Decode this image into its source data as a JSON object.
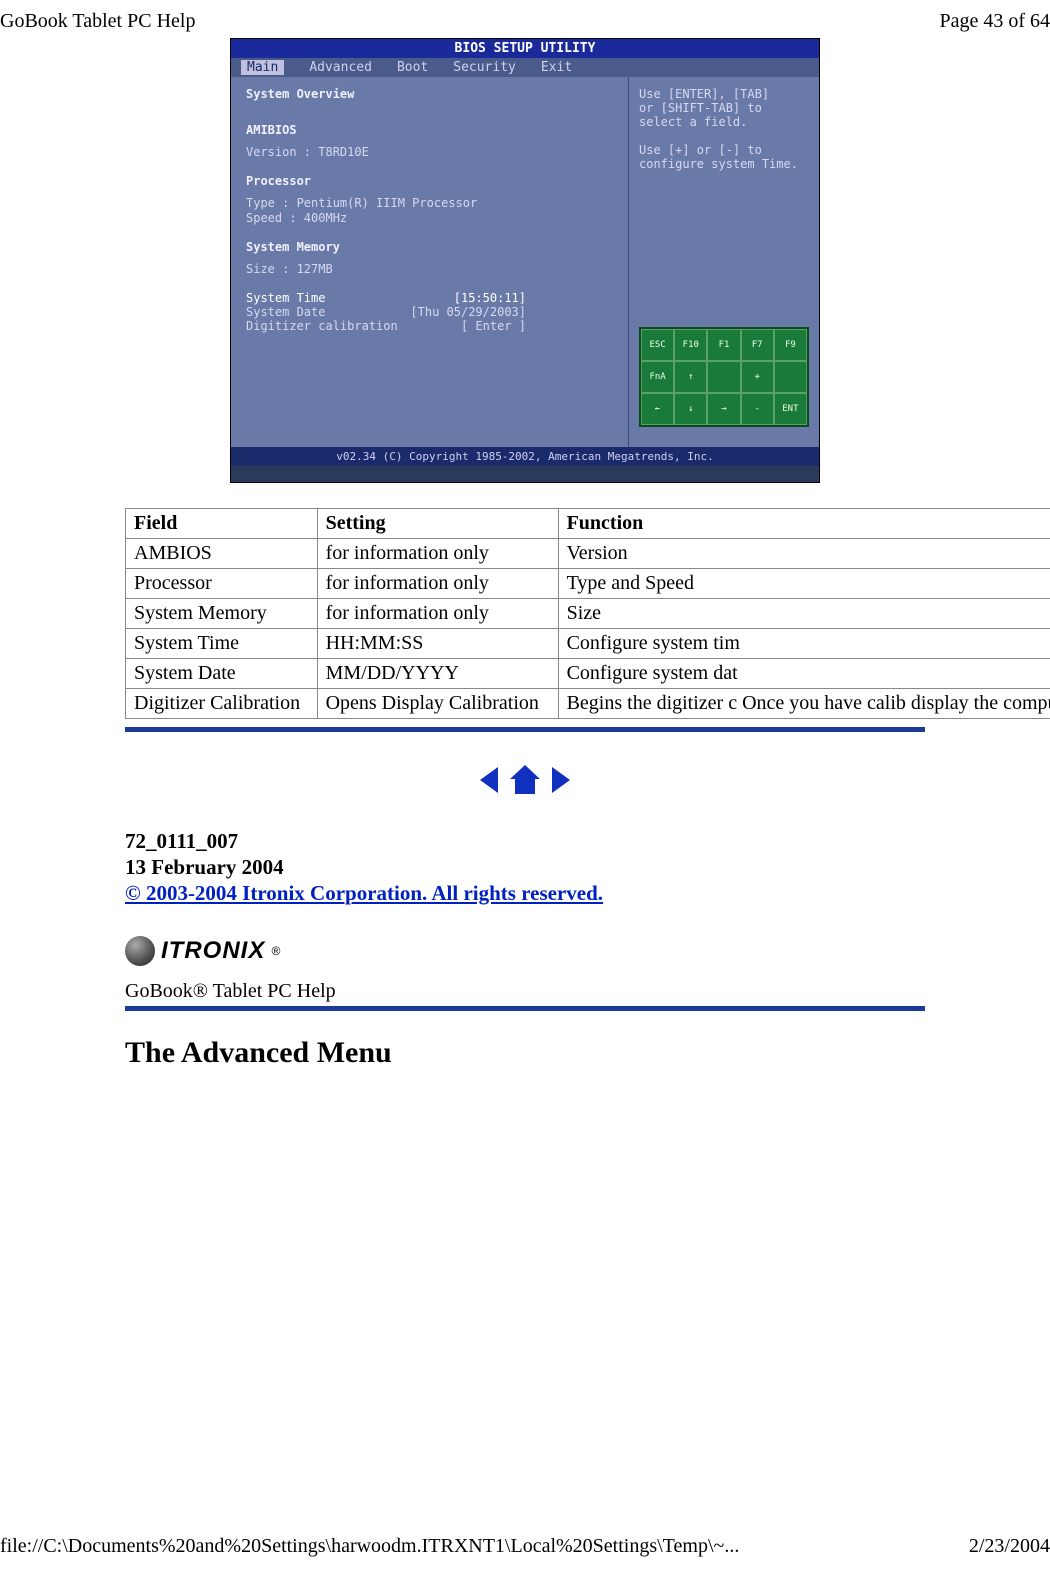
{
  "header": {
    "left": "GoBook Tablet PC Help",
    "right": "Page 43 of 64"
  },
  "bios": {
    "title": "BIOS SETUP UTILITY",
    "menu": [
      "Main",
      "Advanced",
      "Boot",
      "Security",
      "Exit"
    ],
    "left": {
      "overview": "System Overview",
      "amibios": "AMIBIOS",
      "version": "Version   : T8RD10E",
      "processor": "Processor",
      "ptype": "Type     : Pentium(R) IIIM Processor",
      "pspeed": "Speed    : 400MHz",
      "sysmem": "System Memory",
      "size": "Size     : 127MB",
      "systime": "System Time",
      "systime_val": "[15:50:11]",
      "sysdate": "System Date",
      "sysdate_val": "[Thu 05/29/2003]",
      "digi": "Digitizer calibration",
      "digi_val": "[ Enter ]"
    },
    "right": {
      "help1": "Use [ENTER], [TAB]",
      "help2": "or [SHIFT-TAB] to",
      "help3": "select a field.",
      "help4": "Use [+] or [-] to",
      "help5": "configure system Time."
    },
    "keys": [
      "ESC",
      "F10",
      "F1",
      "F7",
      "F9",
      "FnA",
      "↑",
      "",
      "+",
      "",
      "←",
      "↓",
      "→",
      "-",
      "ENT"
    ],
    "footer": "v02.34 (C) Copyright 1985-2002, American Megatrends, Inc."
  },
  "table": {
    "headers": [
      "Field",
      "Setting",
      "Function"
    ],
    "rows": [
      [
        "AMBIOS",
        "for information only",
        "Version"
      ],
      [
        "Processor",
        "for information only",
        "Type and Speed"
      ],
      [
        "System Memory",
        "for information only",
        "Size"
      ],
      [
        "System Time",
        "HH:MM:SS",
        "Configure system tim"
      ],
      [
        "System Date",
        "MM/DD/YYYY",
        "Configure system dat"
      ],
      [
        "Digitizer Calibration",
        "Opens Display Calibration",
        "Begins the digitizer c  Once you have calib display the computer restart."
      ]
    ]
  },
  "docinfo": {
    "id": "72_0111_007",
    "date": "13 February 2004",
    "copyright": "© 2003-2004 Itronix Corporation.  All rights reserved."
  },
  "logo_text": "ITRONIX",
  "subtitle": "GoBook® Tablet PC Help",
  "section_heading": "The Advanced Menu",
  "footer": {
    "left": "file://C:\\Documents%20and%20Settings\\harwoodm.ITRXNT1\\Local%20Settings\\Temp\\~...",
    "right": "2/23/2004"
  }
}
